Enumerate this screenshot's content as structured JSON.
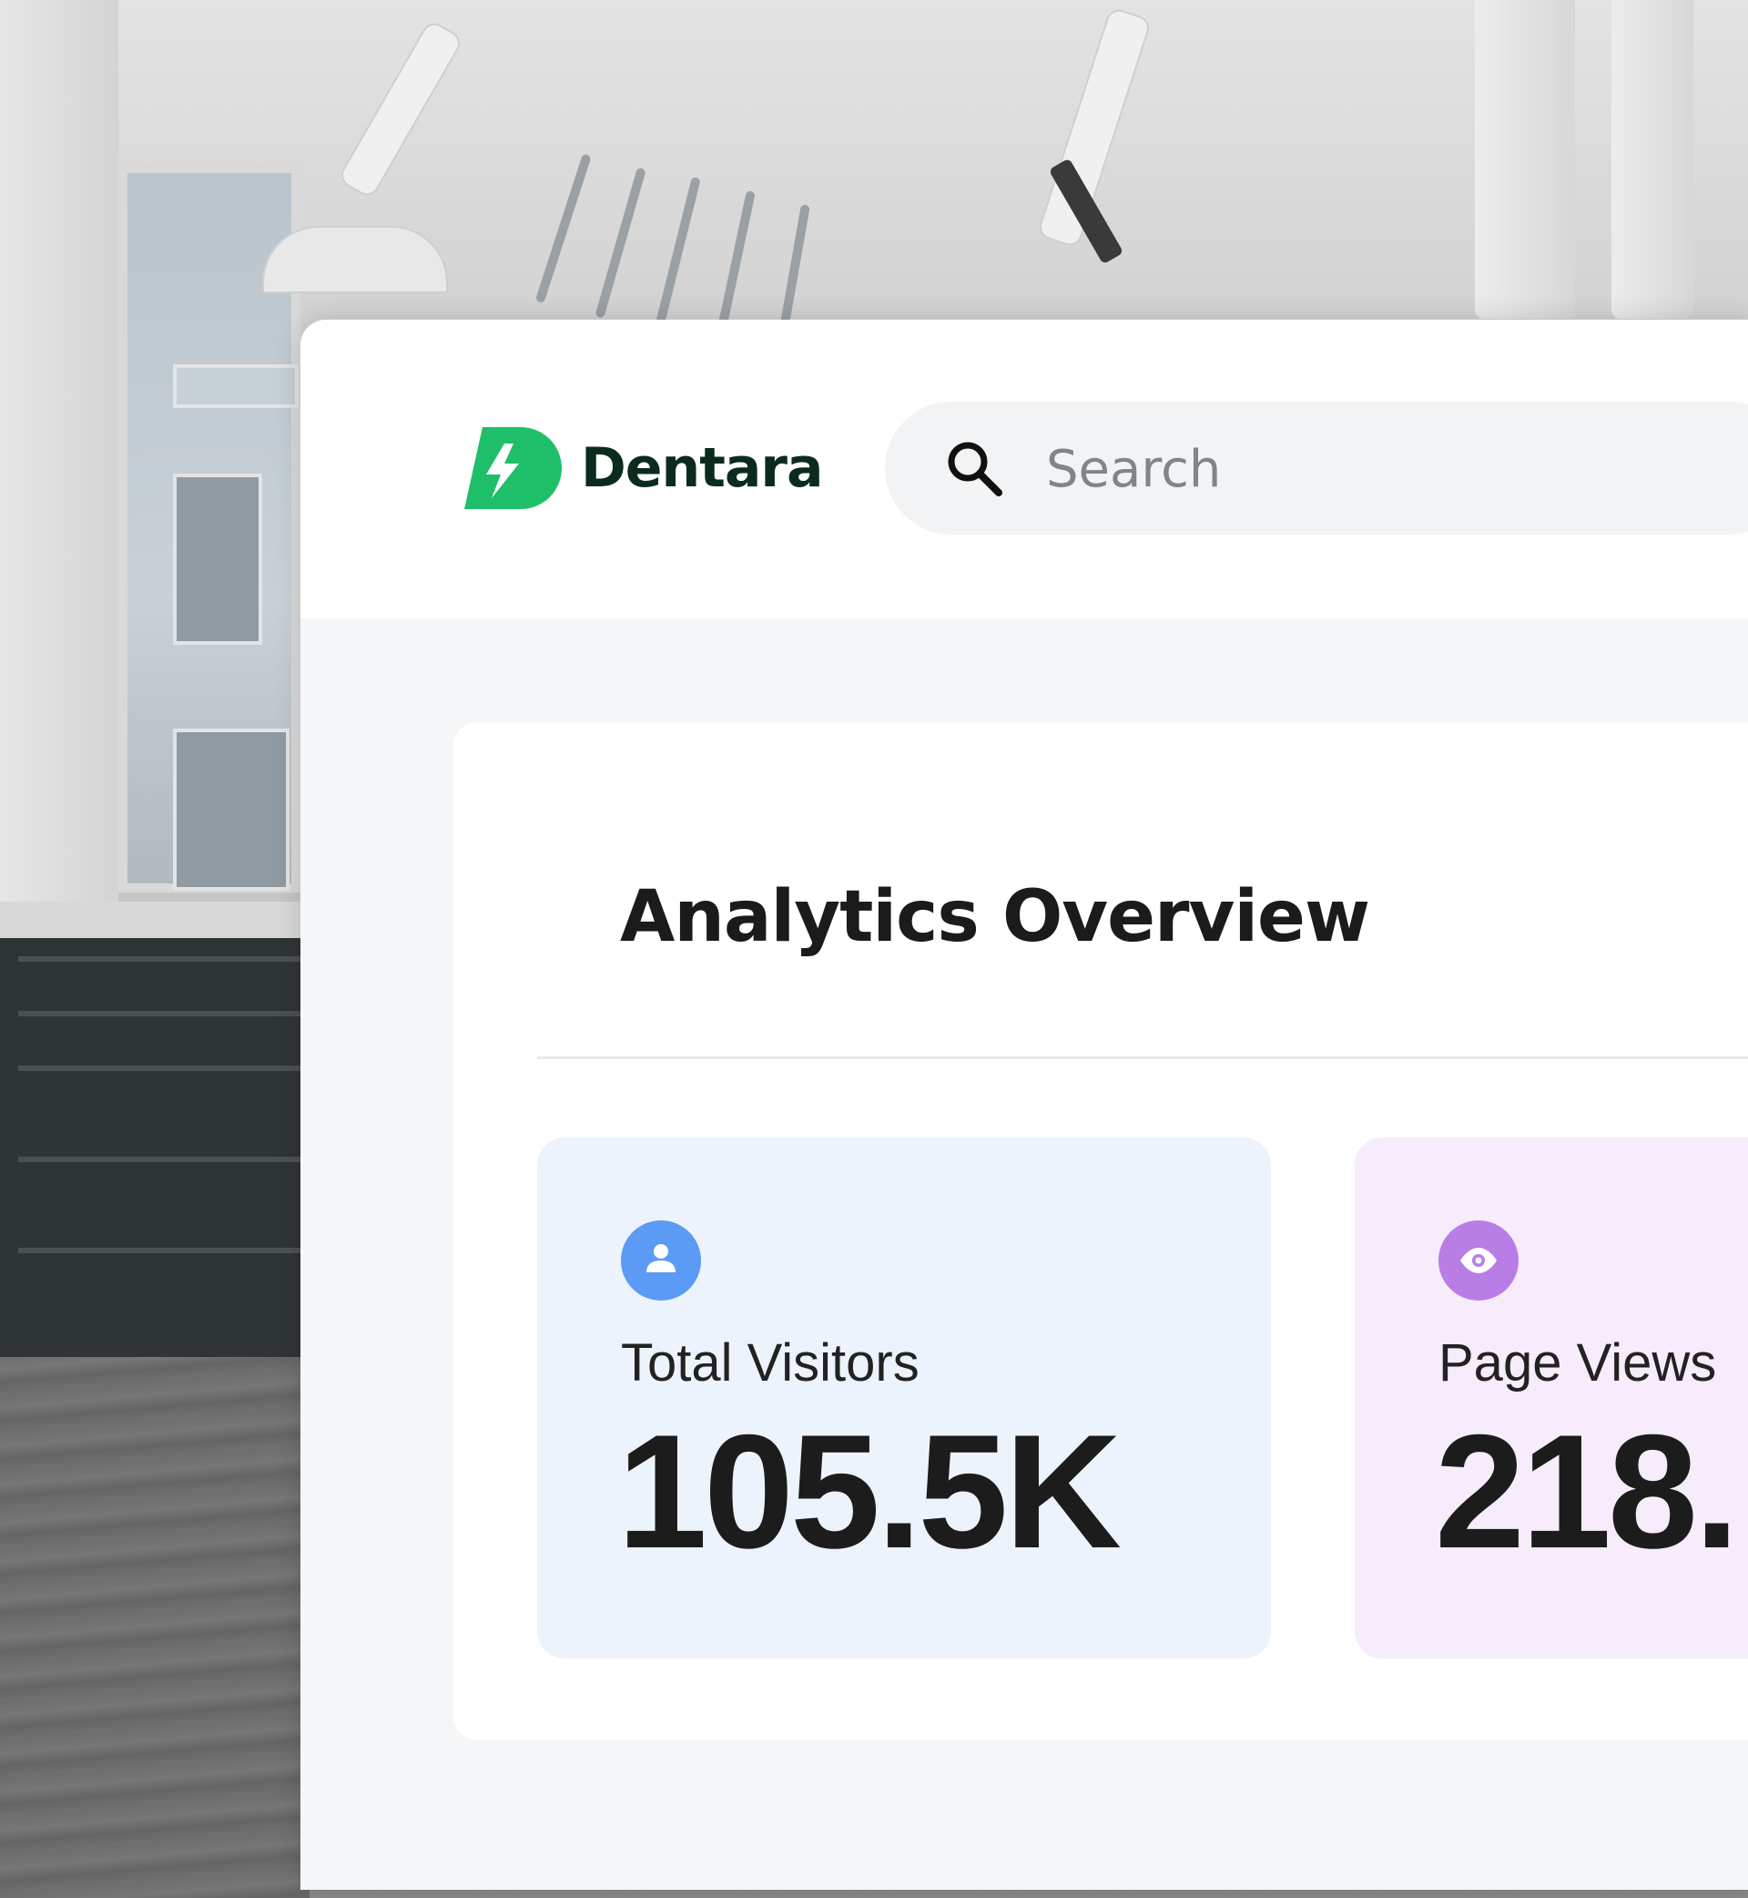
{
  "brand": {
    "name": "Dentara",
    "accent_color": "#1fbf6a",
    "text_color": "#0b2b1d"
  },
  "search": {
    "placeholder": "Search",
    "icon": "search-icon"
  },
  "analytics": {
    "title": "Analytics Overview",
    "cards": [
      {
        "label": "Total Visitors",
        "value": "105.5K",
        "icon": "user-icon",
        "icon_color": "#5b9af5",
        "card_color": "#edf3fd"
      },
      {
        "label": "Page Views",
        "value": "218.",
        "icon": "eye-icon",
        "icon_color": "#b97ee6",
        "card_color": "#f6ecfb"
      }
    ]
  }
}
